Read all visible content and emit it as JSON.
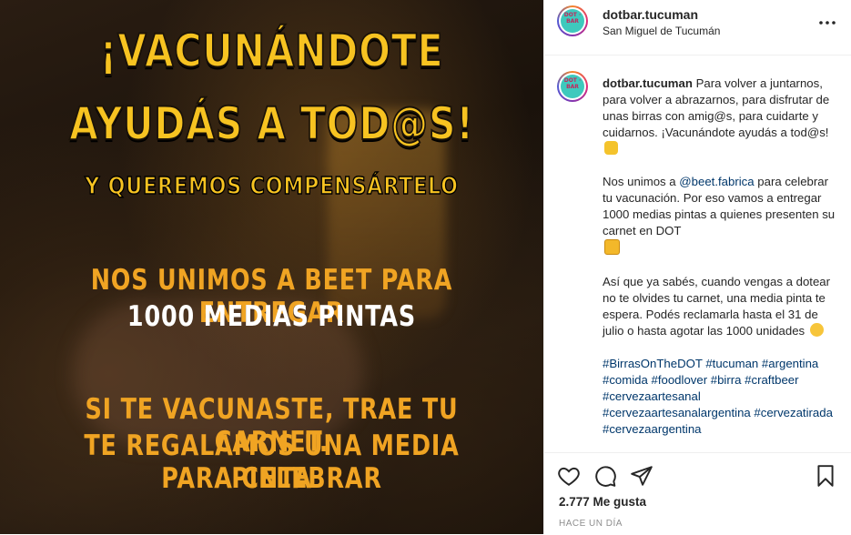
{
  "post": {
    "image": {
      "headline_line1": "¡Vacunándote",
      "headline_line2": "ayudás a tod@s!",
      "subheadline": "Y queremos compensártelo",
      "line1": "Nos unimos a Beet para entregar",
      "line2": "1000 medias pintas",
      "line3": "Si te vacunaste, trae tu carnet.",
      "line4": "Te regalamos una media pinta",
      "line5": "para celebrar",
      "colors": {
        "accent": "#f7c321",
        "orange": "#f0a423",
        "white": "#ffffff"
      }
    }
  },
  "header": {
    "avatar_text": "DOT · BAR",
    "username": "dotbar.tucuman",
    "location": "San Miguel de Tucumán",
    "more_icon": "more-horizontal-icon"
  },
  "caption": {
    "username": "dotbar.tucuman",
    "para1": "Para volver a juntarnos, para volver a abrazarnos, para disfrutar de unas birras con amig@s, para cuidarte y cuidarnos. ¡Vacunándote ayudás a tod@s!",
    "para2_a": "Nos unimos a ",
    "mention": "@beet.fabrica",
    "para2_b": " para celebrar tu vacunación. Por eso vamos a entregar 1000 medias pintas a quienes presenten su carnet en DOT",
    "para3": "Así que ya sabés, cuando vengas a dotear no te olvides tu carnet, una media pinta te espera. Podés reclamarla hasta el 31 de julio o hasta agotar las 1000 unidades",
    "hashtags": "#BirrasOnTheDOT #tucuman #argentina #comida #foodlover #birra #craftbeer #cervezaartesanal #cervezaartesanalargentina #cervezatirada #cervezaargentina"
  },
  "actions": {
    "likes": "2.777 Me gusta",
    "time": "HACE UN DÍA"
  }
}
